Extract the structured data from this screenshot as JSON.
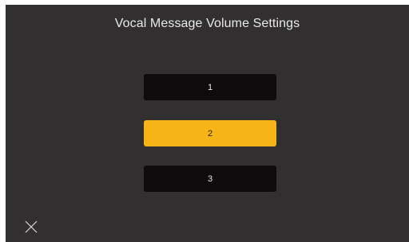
{
  "screen": {
    "title": "Vocal Message Volume Settings"
  },
  "options": [
    {
      "label": "1",
      "selected": false
    },
    {
      "label": "2",
      "selected": true
    },
    {
      "label": "3",
      "selected": false
    }
  ],
  "close": {
    "icon": "close-icon"
  },
  "colors": {
    "background": "#322f30",
    "button": "#0d0b0c",
    "accent": "#f6b417",
    "text": "#e8e8e8"
  }
}
